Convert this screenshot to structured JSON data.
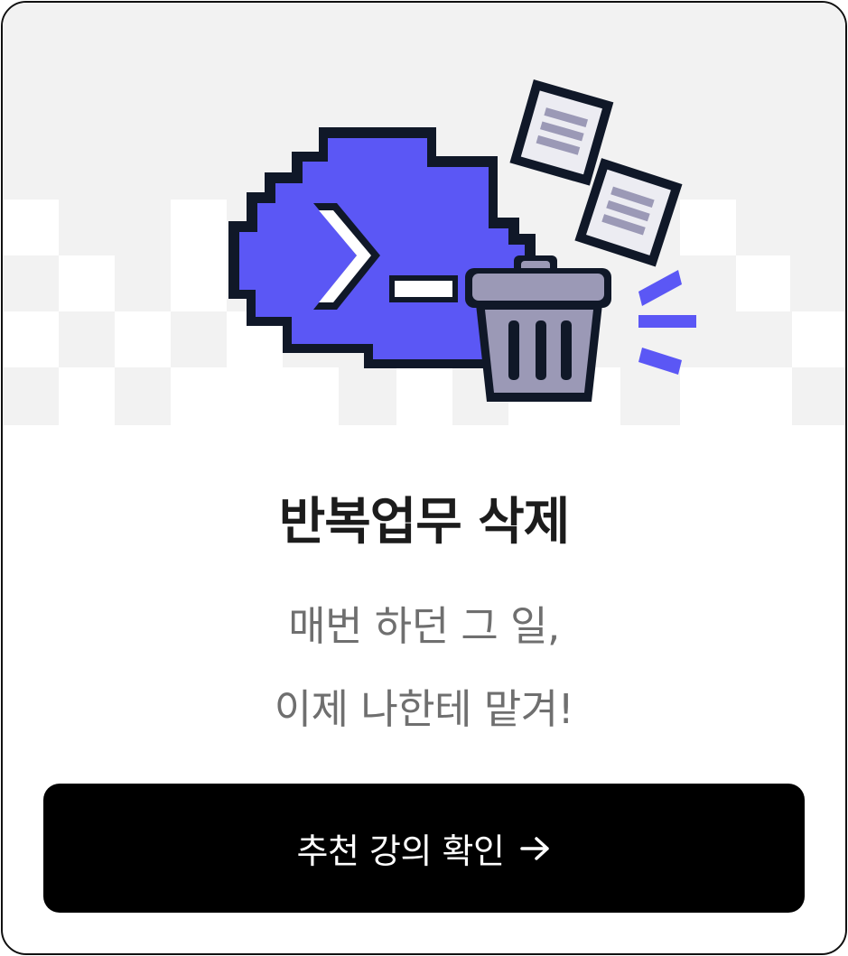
{
  "card": {
    "title": "반복업무 삭제",
    "subtitle_line1": "매번 하던 그 일,",
    "subtitle_line2": "이제 나한테 맡겨!",
    "cta_label": "추천 강의 확인",
    "cta_icon": "arrow-right-icon"
  },
  "illustration": {
    "elements": [
      "terminal-cloud-icon",
      "trash-can-icon",
      "paper-document-icon",
      "paper-document-icon",
      "motion-lines-icon"
    ]
  },
  "colors": {
    "accent": "#5b57f5",
    "outline": "#101828",
    "trash": "#9b99b6",
    "paper": "#ececf2",
    "button": "#000000",
    "title": "#1c1c1c",
    "subtitle": "#6f6f6f"
  }
}
